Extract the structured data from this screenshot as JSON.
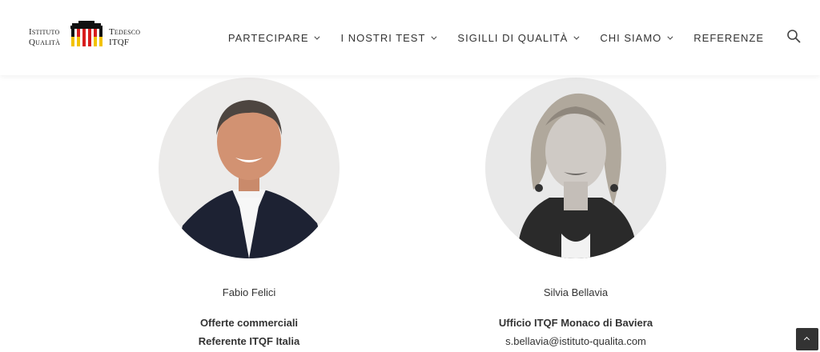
{
  "logo": {
    "line1_left": "Istituto",
    "line2_left": "Qualità",
    "line1_right": "Tedesco",
    "line2_right": "ITQF"
  },
  "nav": {
    "items": [
      {
        "label": "PARTECIPARE",
        "dropdown": true
      },
      {
        "label": "I NOSTRI TEST",
        "dropdown": true
      },
      {
        "label": "SIGILLI DI QUALITÀ",
        "dropdown": true
      },
      {
        "label": "CHI SIAMO",
        "dropdown": true
      },
      {
        "label": "REFERENZE",
        "dropdown": false
      }
    ],
    "search_icon": "search-icon"
  },
  "people": [
    {
      "name": "Fabio Felici",
      "role_line1": "Offerte commerciali",
      "role_line2": "Referente ITQF Italia"
    },
    {
      "name": "Silvia Bellavia",
      "role_line1": "Ufficio ITQF Monaco di Baviera",
      "email": "s.bellavia@istituto-qualita.com"
    }
  ],
  "colors": {
    "flag_black": "#111111",
    "flag_red": "#d81e1e",
    "flag_gold": "#f2c200",
    "back_to_top": "#333333"
  }
}
